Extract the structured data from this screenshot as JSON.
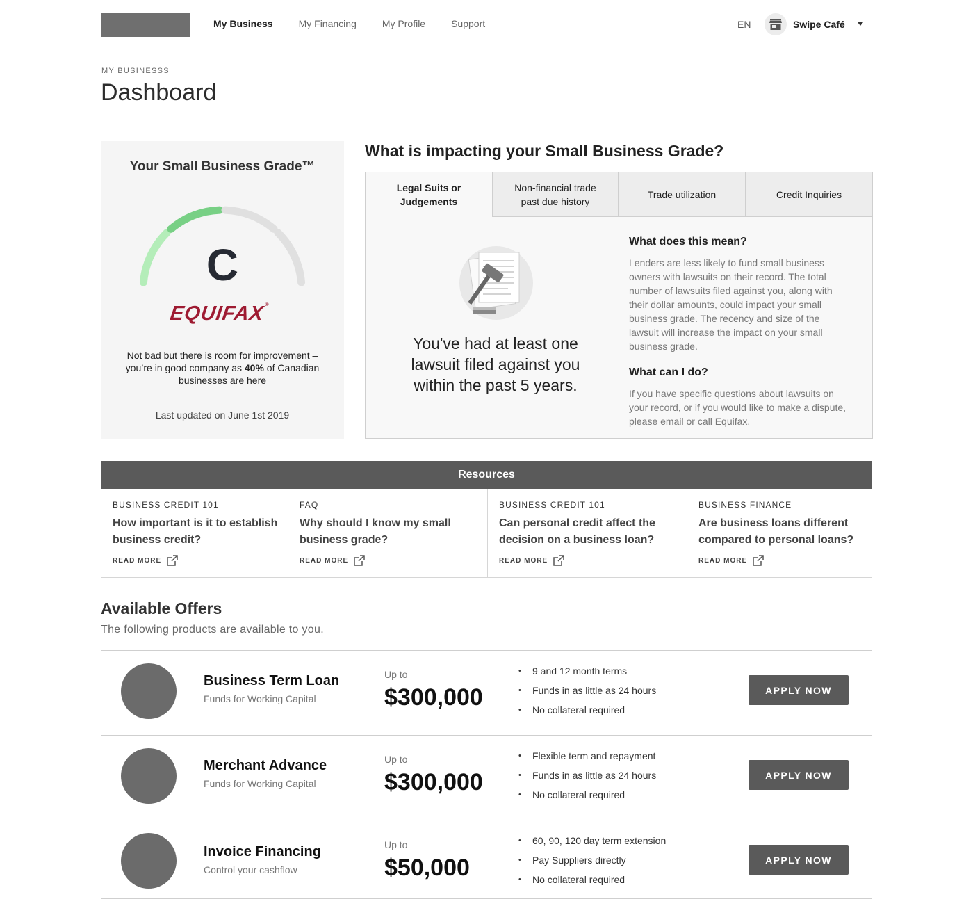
{
  "nav": {
    "links": [
      "My Business",
      "My Financing",
      "My Profile",
      "Support"
    ],
    "language": "EN",
    "account_name": "Swipe Café"
  },
  "header": {
    "eyebrow": "MY BUSINESSS",
    "title": "Dashboard"
  },
  "grade": {
    "title": "Your Small Business Grade™",
    "letter": "C",
    "brand": "EQUIFAX",
    "description_pre": "Not bad but there is room for improvement – you’re in good company as ",
    "description_percent": "40%",
    "description_post": " of Canadian businesses are here",
    "updated": "Last updated on June 1st 2019",
    "gauge_level": 0.5,
    "colors": {
      "filled_start": "#b4edb9",
      "filled_end": "#78d085",
      "empty": "#e0e0e0"
    }
  },
  "impact": {
    "heading": "What is impacting your Small Business Grade?",
    "tabs": [
      {
        "line1": "Legal Suits or",
        "line2": "Judgements"
      },
      {
        "line1": "Non-financial trade",
        "line2": "past due history"
      },
      {
        "line1": "Trade utilization",
        "line2": ""
      },
      {
        "line1": "Credit Inquiries",
        "line2": ""
      }
    ],
    "message": "You've had at least one lawsuit filed against you within the past 5 years.",
    "what_title": "What does this mean?",
    "what_text": "Lenders are less likely to fund small business owners with lawsuits on their record. The total number of lawsuits filed against you, along with their dollar amounts, could impact your small business grade. The recency and size of the lawsuit will increase the impact on your small business grade.",
    "can_title": "What can I do?",
    "can_text": "If you have specific questions about lawsuits on your record, or if you would like to make a dispute, please email or call Equifax."
  },
  "resources": {
    "title": "Resources",
    "read_more": "READ MORE",
    "items": [
      {
        "category": "BUSINESS CREDIT 101",
        "question": "How important is it to establish business credit?"
      },
      {
        "category": "FAQ",
        "question": "Why should I know my small business grade?"
      },
      {
        "category": "BUSINESS CREDIT 101",
        "question": "Can personal credit affect the decision on a business loan?"
      },
      {
        "category": "BUSINESS FINANCE",
        "question": "Are business loans different compared to personal loans?"
      }
    ]
  },
  "offers": {
    "title": "Available Offers",
    "subtitle": "The following products are available to you.",
    "up_to": "Up to",
    "apply_label": "APPLY NOW",
    "items": [
      {
        "name": "Business Term Loan",
        "desc": "Funds for Working Capital",
        "amount": "$300,000",
        "features": [
          "9 and 12 month terms",
          "Funds in as little as 24 hours",
          "No collateral required"
        ]
      },
      {
        "name": "Merchant Advance",
        "desc": "Funds for Working Capital",
        "amount": "$300,000",
        "features": [
          "Flexible term and repayment",
          "Funds in as little as 24 hours",
          "No collateral required"
        ]
      },
      {
        "name": "Invoice Financing",
        "desc": "Control your cashflow",
        "amount": "$50,000",
        "features": [
          "60, 90, 120 day term extension",
          "Pay Suppliers directly",
          "No collateral required"
        ]
      }
    ]
  }
}
